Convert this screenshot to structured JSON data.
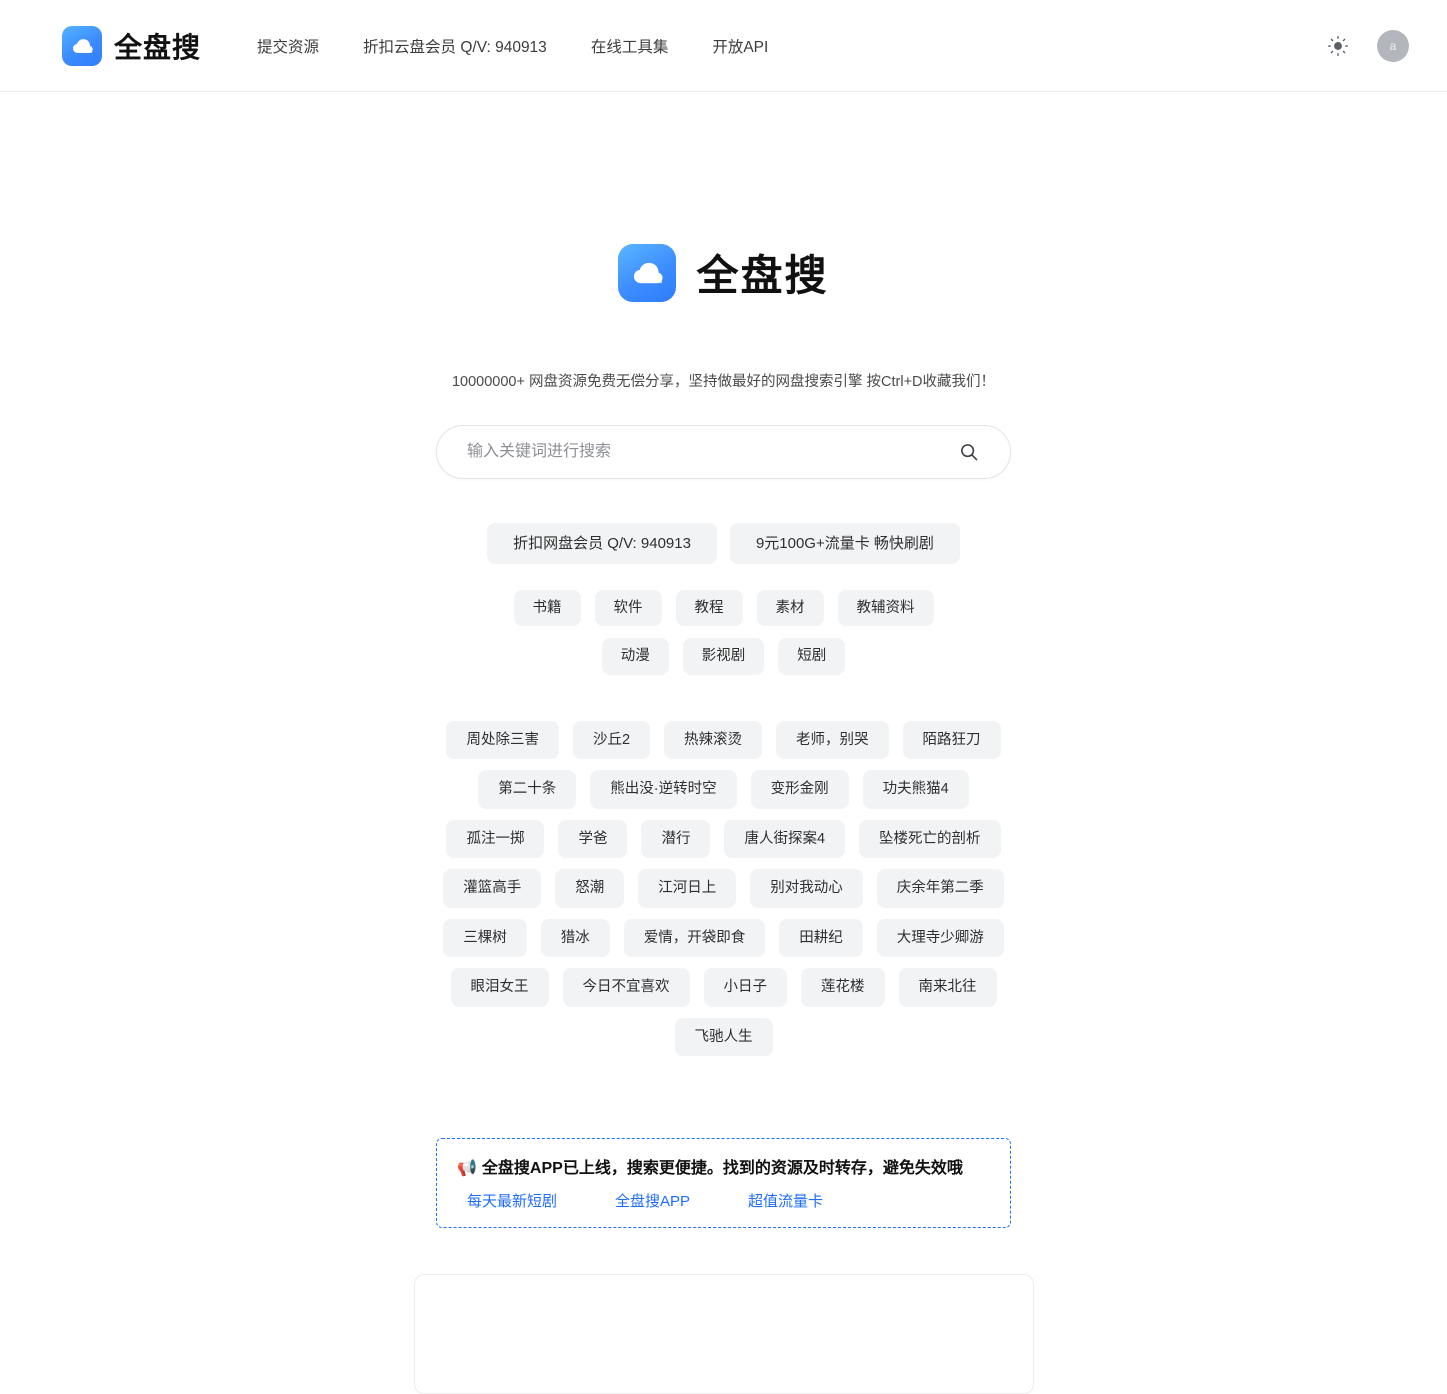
{
  "header": {
    "brand_name": "全盘搜",
    "logo_icon": "cloud-icon",
    "nav": [
      {
        "label": "提交资源"
      },
      {
        "label": "折扣云盘会员 Q/V: 940913"
      },
      {
        "label": "在线工具集"
      },
      {
        "label": "开放API"
      }
    ],
    "theme_toggle_icon": "sun-icon",
    "avatar_letter": "a"
  },
  "hero": {
    "logo_icon": "cloud-icon",
    "title": "全盘搜",
    "subtitle": "10000000+ 网盘资源免费无偿分享，坚持做最好的网盘搜索引擎 按Ctrl+D收藏我们！"
  },
  "search": {
    "placeholder": "输入关键词进行搜索",
    "value": "",
    "icon": "search-icon"
  },
  "promo_chips": [
    {
      "label": "折扣网盘会员 Q/V: 940913"
    },
    {
      "label": "9元100G+流量卡 畅快刷剧"
    }
  ],
  "category_chips": [
    {
      "label": "书籍"
    },
    {
      "label": "软件"
    },
    {
      "label": "教程"
    },
    {
      "label": "素材"
    },
    {
      "label": "教辅资料"
    },
    {
      "label": "动漫"
    },
    {
      "label": "影视剧"
    },
    {
      "label": "短剧"
    }
  ],
  "hot_chips": [
    {
      "label": "周处除三害"
    },
    {
      "label": "沙丘2"
    },
    {
      "label": "热辣滚烫"
    },
    {
      "label": "老师，别哭"
    },
    {
      "label": "陌路狂刀"
    },
    {
      "label": "第二十条"
    },
    {
      "label": "熊出没·逆转时空"
    },
    {
      "label": "变形金刚"
    },
    {
      "label": "功夫熊猫4"
    },
    {
      "label": "孤注一掷"
    },
    {
      "label": "学爸"
    },
    {
      "label": "潜行"
    },
    {
      "label": "唐人街探案4"
    },
    {
      "label": "坠楼死亡的剖析"
    },
    {
      "label": "灌篮高手"
    },
    {
      "label": "怒潮"
    },
    {
      "label": "江河日上"
    },
    {
      "label": "别对我动心"
    },
    {
      "label": "庆余年第二季"
    },
    {
      "label": "三棵树"
    },
    {
      "label": "猎冰"
    },
    {
      "label": "爱情，开袋即食"
    },
    {
      "label": "田耕纪"
    },
    {
      "label": "大理寺少卿游"
    },
    {
      "label": "眼泪女王"
    },
    {
      "label": "今日不宜喜欢"
    },
    {
      "label": "小日子"
    },
    {
      "label": "莲花楼"
    },
    {
      "label": "南来北往"
    },
    {
      "label": "飞驰人生"
    }
  ],
  "announcement": {
    "emoji": "📢",
    "text": "全盘搜APP已上线，搜索更便捷。找到的资源及时转存，避免失效哦",
    "links": [
      {
        "label": "每天最新短剧"
      },
      {
        "label": "全盘搜APP"
      },
      {
        "label": "超值流量卡"
      }
    ]
  },
  "colors": {
    "brand_blue": "#2f7dfb",
    "link_blue": "#1f6dfb",
    "chip_bg": "#f2f3f5"
  }
}
